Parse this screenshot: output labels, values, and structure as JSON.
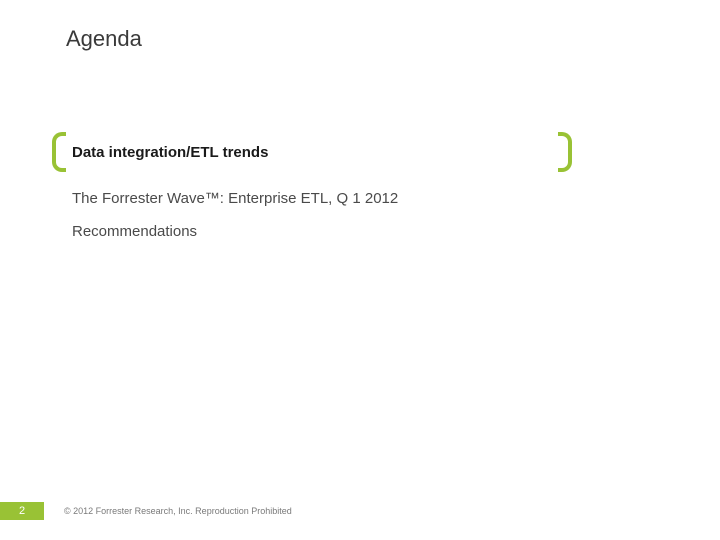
{
  "title": "Agenda",
  "agenda": {
    "highlighted": "Data integration/ETL trends",
    "items": [
      "The Forrester Wave™: Enterprise ETL, Q 1 2012",
      "Recommendations"
    ]
  },
  "footer": {
    "page_number": "2",
    "copyright": "© 2012 Forrester Research, Inc. Reproduction Prohibited"
  },
  "colors": {
    "accent": "#99c235"
  }
}
